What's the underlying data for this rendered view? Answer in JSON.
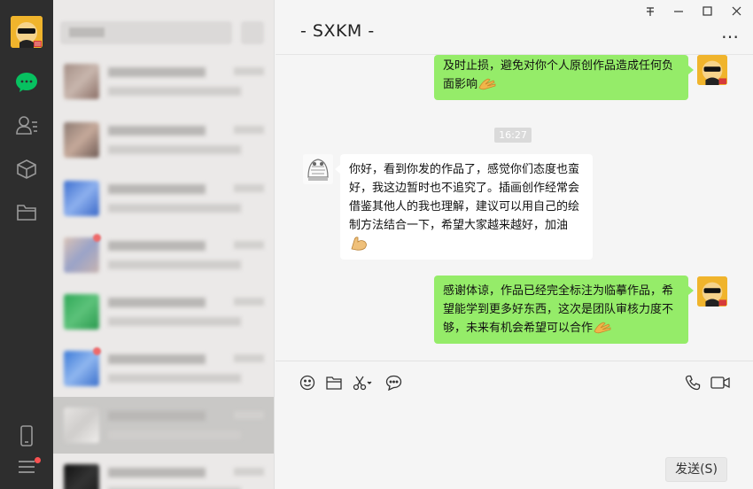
{
  "colors": {
    "rail_bg": "#2e2e2e",
    "list_bg": "#ebe9e8",
    "chat_bg": "#f5f5f5",
    "my_bubble": "#95ec69",
    "other_bubble": "#ffffff",
    "accent_green": "#07c160",
    "badge_red": "#fa5151"
  },
  "rail": {
    "icons": [
      "avatar",
      "chat-icon",
      "contacts-icon",
      "cube-icon",
      "folder-icon",
      "phone-icon",
      "menu-icon"
    ]
  },
  "chat": {
    "title": "- SXKM -",
    "window_controls": {
      "pin": "",
      "minimize": "—",
      "maximize": "☐",
      "close": "✕"
    },
    "more": "…",
    "messages": [
      {
        "sender": "me",
        "text": "及时止损，避免对你个人原创作品造成任何负面影响",
        "emoji": "clap-hand"
      },
      {
        "type": "time",
        "text": "16:27"
      },
      {
        "sender": "other",
        "text": "你好，看到你发的作品了，感觉你们态度也蛮好，我这边暂时也不追究了。插画创作经常会借鉴其他人的我也理解，建议可以用自己的绘制方法结合一下，希望大家越来越好，加油",
        "emoji": "flexed-biceps"
      },
      {
        "sender": "me",
        "text": "感谢体谅，作品已经完全标注为临摹作品，希望能学到更多好东西，这次是团队审核力度不够，未来有机会希望可以合作",
        "emoji": "clap-hand"
      }
    ],
    "toolbar": [
      "emoji-icon",
      "folder-icon",
      "scissors-icon",
      "chat-bubble-icon",
      "phone-icon",
      "video-icon"
    ],
    "send_label": "发送(S)"
  }
}
